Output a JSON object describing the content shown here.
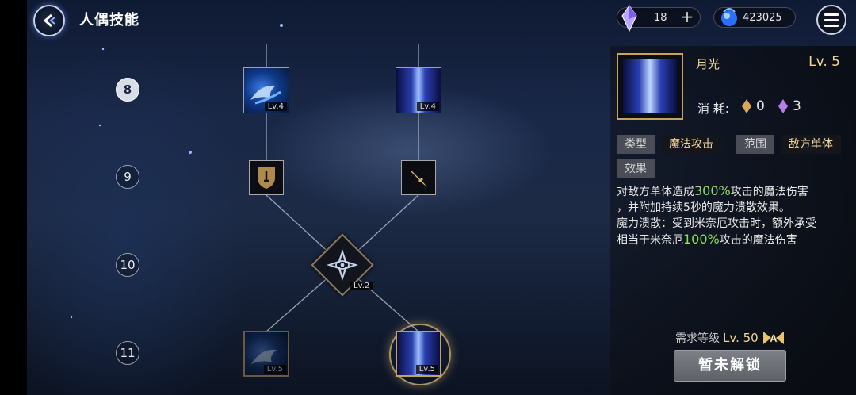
{
  "header": {
    "title": "人偶技能",
    "crystal_count": "18",
    "mana_count": "423025"
  },
  "tiers": [
    "8",
    "9",
    "10",
    "11"
  ],
  "tree": {
    "tier8_left_lv": "Lv.4",
    "tier8_right_lv": "Lv.4",
    "tier10_lv": "Lv.2",
    "tier11_left_lv": "Lv.5",
    "tier11_right_lv": "Lv.5"
  },
  "detail": {
    "name": "月光",
    "level": "Lv. 5",
    "cost_label": "消 耗:",
    "cost_gold": "0",
    "cost_purple": "3",
    "type_key": "类型",
    "type_val": "魔法攻击",
    "range_key": "范围",
    "range_val": "敌方单体",
    "effect_key": "效果",
    "desc_1a": "对敌方单体造成",
    "desc_1b": "300%",
    "desc_1c": "攻击的魔法伤害",
    "desc_2": "，并附加持续5秒的魔力溃散效果。",
    "desc_3": "魔力溃散：受到米奈厄攻击时，额外承受",
    "desc_4a": "相当于米奈厄",
    "desc_4b": "100%",
    "desc_4c": "攻击的魔法伤害",
    "req_label": "需求等级",
    "req_level": "Lv. 50",
    "unlock_label": "暂未解锁"
  },
  "colors": {
    "gold": "#f0d79a",
    "highlight": "#8be060",
    "frame_gold": "#c9a25a"
  }
}
